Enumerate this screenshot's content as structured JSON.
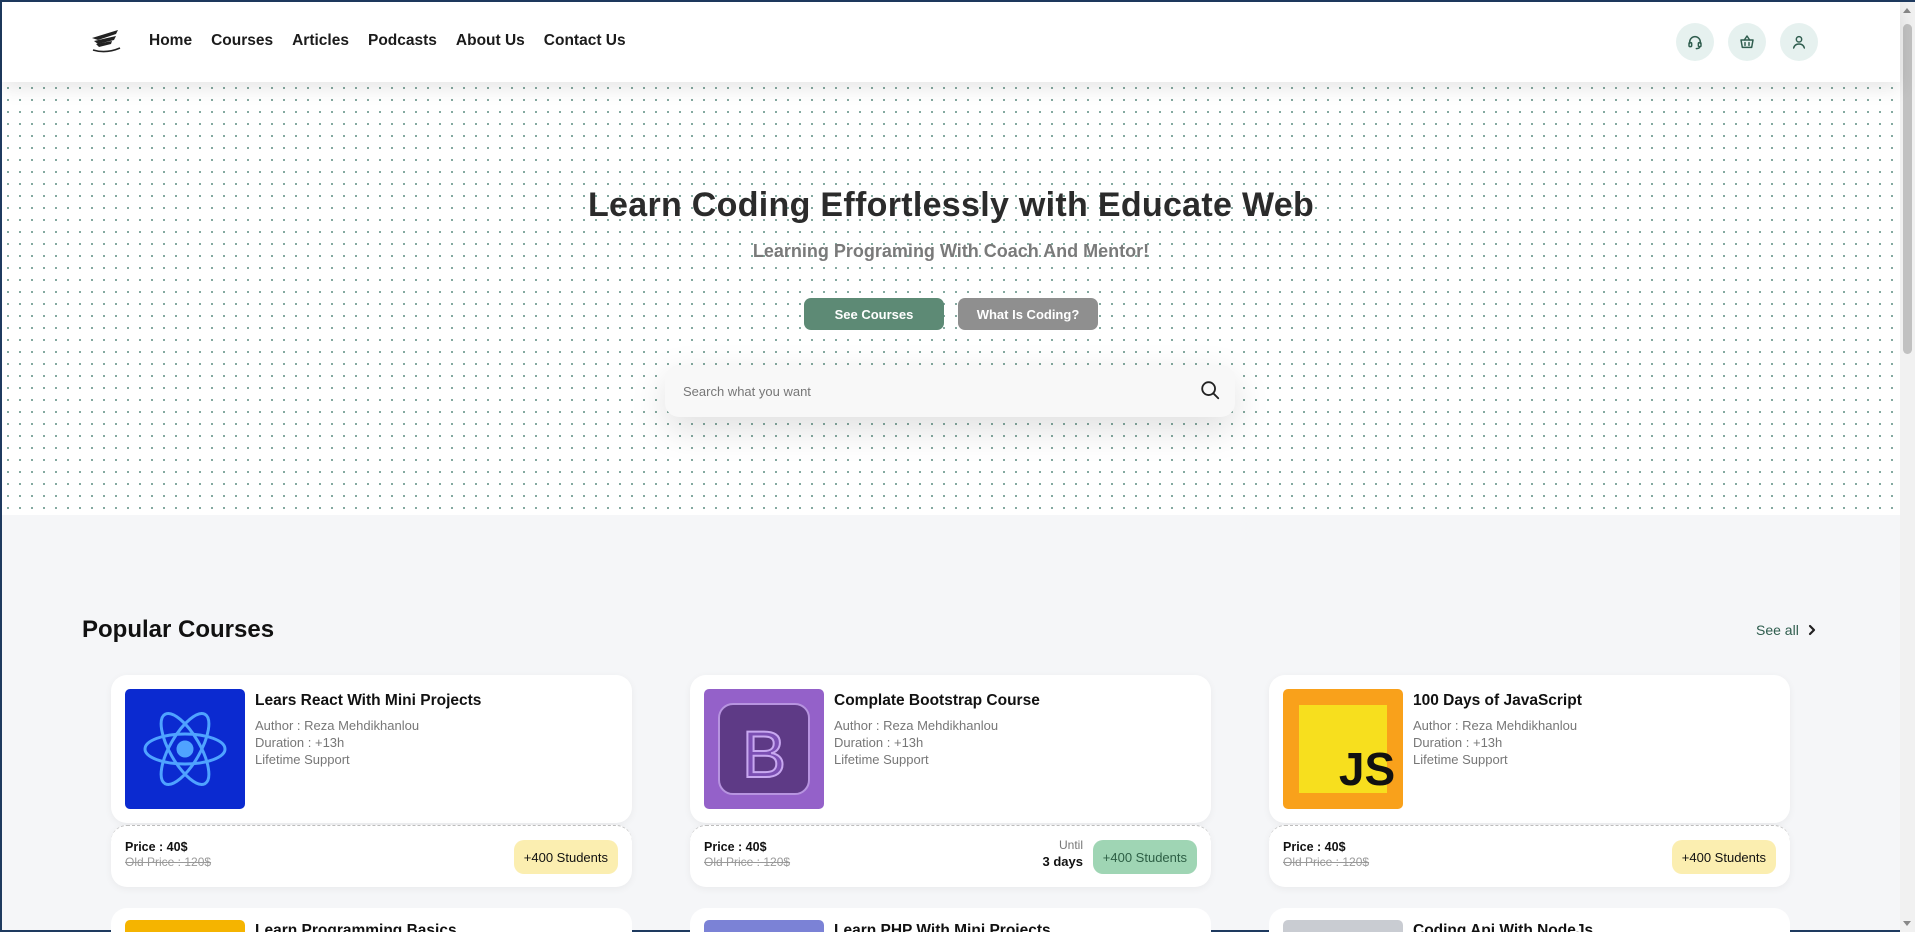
{
  "header": {
    "nav": [
      "Home",
      "Courses",
      "Articles",
      "Podcasts",
      "About Us",
      "Contact Us"
    ],
    "icons": [
      "headset-icon",
      "basket-icon",
      "user-icon"
    ]
  },
  "hero": {
    "title": "Learn Coding Effortlessly with Educate Web",
    "subtitle": "Learning Programing With Coach And Mentor!",
    "primary_button": "See Courses",
    "secondary_button": "What Is Coding?",
    "search_placeholder": "Search what you want"
  },
  "popular": {
    "title": "Popular Courses",
    "see_all": "See all",
    "courses": [
      {
        "title": "Lears React With Mini Projects",
        "author": "Author : Reza Mehdikhanlou",
        "duration": "Duration : +13h",
        "support": "Lifetime Support",
        "price": "Price : 40$",
        "old_price": "Old Price : 120$",
        "students": "+400 Students",
        "icon": "react-logo",
        "thumb_color": "#0b2ad0"
      },
      {
        "title": "Complate Bootstrap Course",
        "author": "Author : Reza Mehdikhanlou",
        "duration": "Duration : +13h",
        "support": "Lifetime Support",
        "price": "Price : 40$",
        "old_price": "Old Price : 120$",
        "students": "+400 Students",
        "until_label": "Until",
        "until_value": "3 days",
        "icon": "bootstrap-logo",
        "thumb_color": "#9461c9"
      },
      {
        "title": "100 Days of JavaScript",
        "author": "Author : Reza Mehdikhanlou",
        "duration": "Duration : +13h",
        "support": "Lifetime Support",
        "price": "Price : 40$",
        "old_price": "Old Price : 120$",
        "students": "+400 Students",
        "icon": "javascript-logo",
        "thumb_color": "#f9a11b"
      }
    ],
    "next_row_titles": [
      "Learn Programming Basics",
      "Learn PHP With Mini Projects",
      "Coding Api With NodeJs"
    ]
  },
  "colors": {
    "accent": "#5d8a75",
    "secondary_button": "#8f8f8f",
    "badge_yellow": "#fbeeb0",
    "badge_green": "#9fd5b4"
  }
}
